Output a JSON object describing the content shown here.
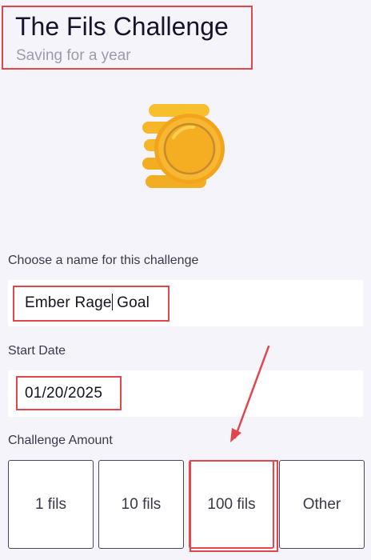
{
  "header": {
    "title": "The Fils Challenge",
    "subtitle": "Saving for a year"
  },
  "illustration": {
    "icon": "coin-icon",
    "colors": {
      "gold": "#f5b62a",
      "gold_dark": "#e69a12",
      "gold_light": "#ffd75a",
      "rim": "#c98a2e"
    }
  },
  "form": {
    "name_field": {
      "label": "Choose a name for this challenge",
      "value": "Ember Rage Goal"
    },
    "start_date_field": {
      "label": "Start Date",
      "value": "01/20/2025"
    },
    "amount_field": {
      "label": "Challenge Amount",
      "options": [
        {
          "label": "1 fils"
        },
        {
          "label": "10 fils"
        },
        {
          "label": "100 fils"
        },
        {
          "label": "Other"
        }
      ],
      "selected": "100 fils"
    }
  },
  "annotation": {
    "highlight_color": "#e0474a"
  }
}
